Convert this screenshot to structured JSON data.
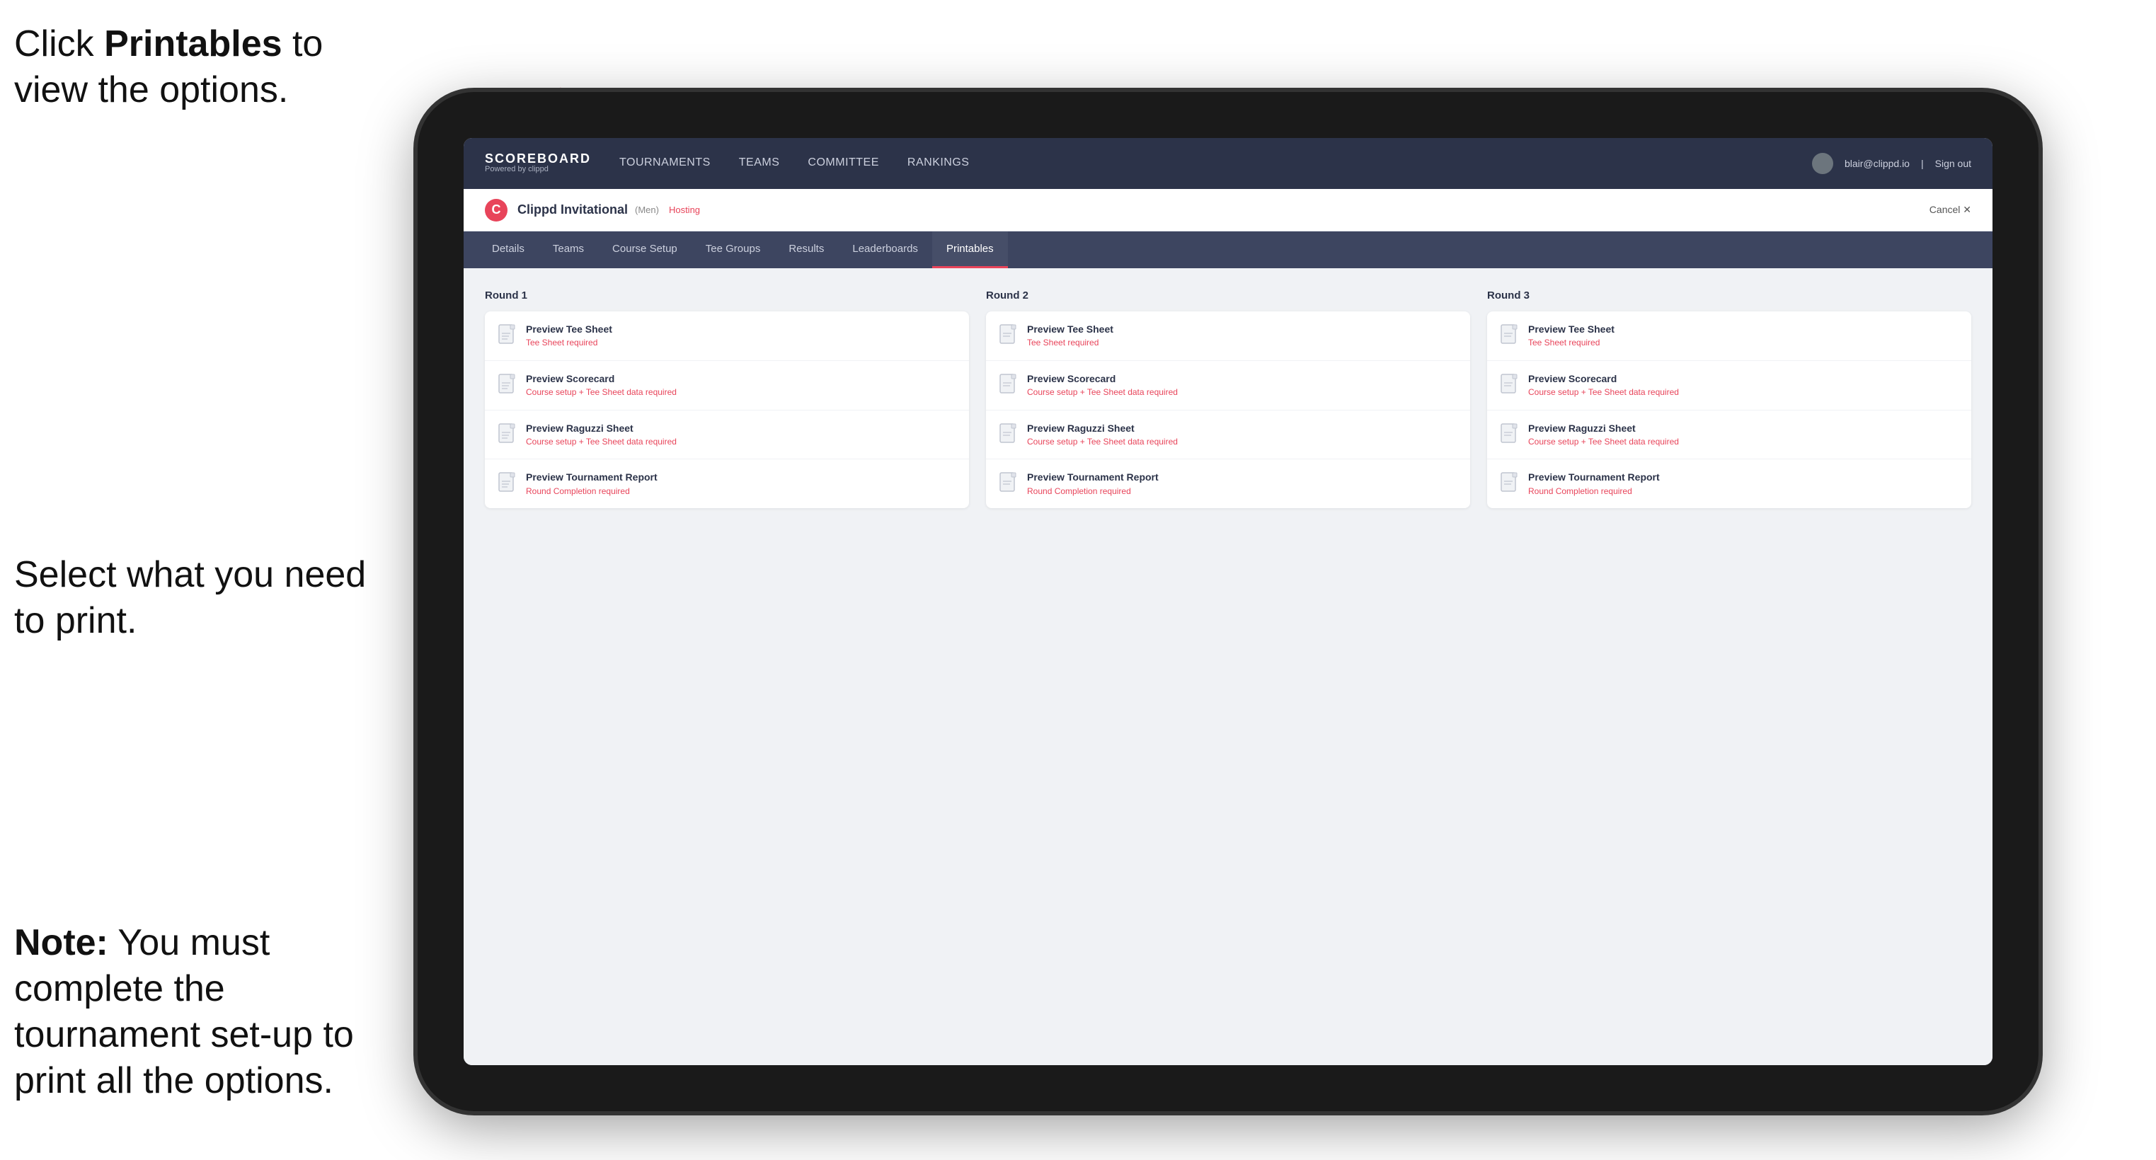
{
  "instructions": {
    "top": "Click Printables to view the options.",
    "top_bold": "Printables",
    "middle": "Select what you need to print.",
    "bottom_bold": "Note:",
    "bottom": " You must complete the tournament set-up to print all the options."
  },
  "topnav": {
    "logo_title": "SCOREBOARD",
    "logo_sub": "Powered by clippd",
    "links": [
      {
        "label": "TOURNAMENTS",
        "active": false
      },
      {
        "label": "TEAMS",
        "active": false
      },
      {
        "label": "COMMITTEE",
        "active": false
      },
      {
        "label": "RANKINGS",
        "active": false
      }
    ],
    "user_email": "blair@clippd.io",
    "sign_out": "Sign out"
  },
  "tournament": {
    "name": "Clippd Invitational",
    "badge": "(Men)",
    "status": "Hosting",
    "cancel": "Cancel ✕"
  },
  "subnav": {
    "items": [
      {
        "label": "Details",
        "active": false
      },
      {
        "label": "Teams",
        "active": false
      },
      {
        "label": "Course Setup",
        "active": false
      },
      {
        "label": "Tee Groups",
        "active": false
      },
      {
        "label": "Results",
        "active": false
      },
      {
        "label": "Leaderboards",
        "active": false
      },
      {
        "label": "Printables",
        "active": true
      }
    ]
  },
  "rounds": [
    {
      "title": "Round 1",
      "cards": [
        {
          "title": "Preview Tee Sheet",
          "sub": "Tee Sheet required",
          "sub_color": "#e8445a"
        },
        {
          "title": "Preview Scorecard",
          "sub": "Course setup + Tee Sheet data required",
          "sub_color": "#e8445a"
        },
        {
          "title": "Preview Raguzzi Sheet",
          "sub": "Course setup + Tee Sheet data required",
          "sub_color": "#e8445a"
        },
        {
          "title": "Preview Tournament Report",
          "sub": "Round Completion required",
          "sub_color": "#e8445a"
        }
      ]
    },
    {
      "title": "Round 2",
      "cards": [
        {
          "title": "Preview Tee Sheet",
          "sub": "Tee Sheet required",
          "sub_color": "#e8445a"
        },
        {
          "title": "Preview Scorecard",
          "sub": "Course setup + Tee Sheet data required",
          "sub_color": "#e8445a"
        },
        {
          "title": "Preview Raguzzi Sheet",
          "sub": "Course setup + Tee Sheet data required",
          "sub_color": "#e8445a"
        },
        {
          "title": "Preview Tournament Report",
          "sub": "Round Completion required",
          "sub_color": "#e8445a"
        }
      ]
    },
    {
      "title": "Round 3",
      "cards": [
        {
          "title": "Preview Tee Sheet",
          "sub": "Tee Sheet required",
          "sub_color": "#e8445a"
        },
        {
          "title": "Preview Scorecard",
          "sub": "Course setup + Tee Sheet data required",
          "sub_color": "#e8445a"
        },
        {
          "title": "Preview Raguzzi Sheet",
          "sub": "Course setup + Tee Sheet data required",
          "sub_color": "#e8445a"
        },
        {
          "title": "Preview Tournament Report",
          "sub": "Round Completion required",
          "sub_color": "#e8445a"
        }
      ]
    }
  ]
}
